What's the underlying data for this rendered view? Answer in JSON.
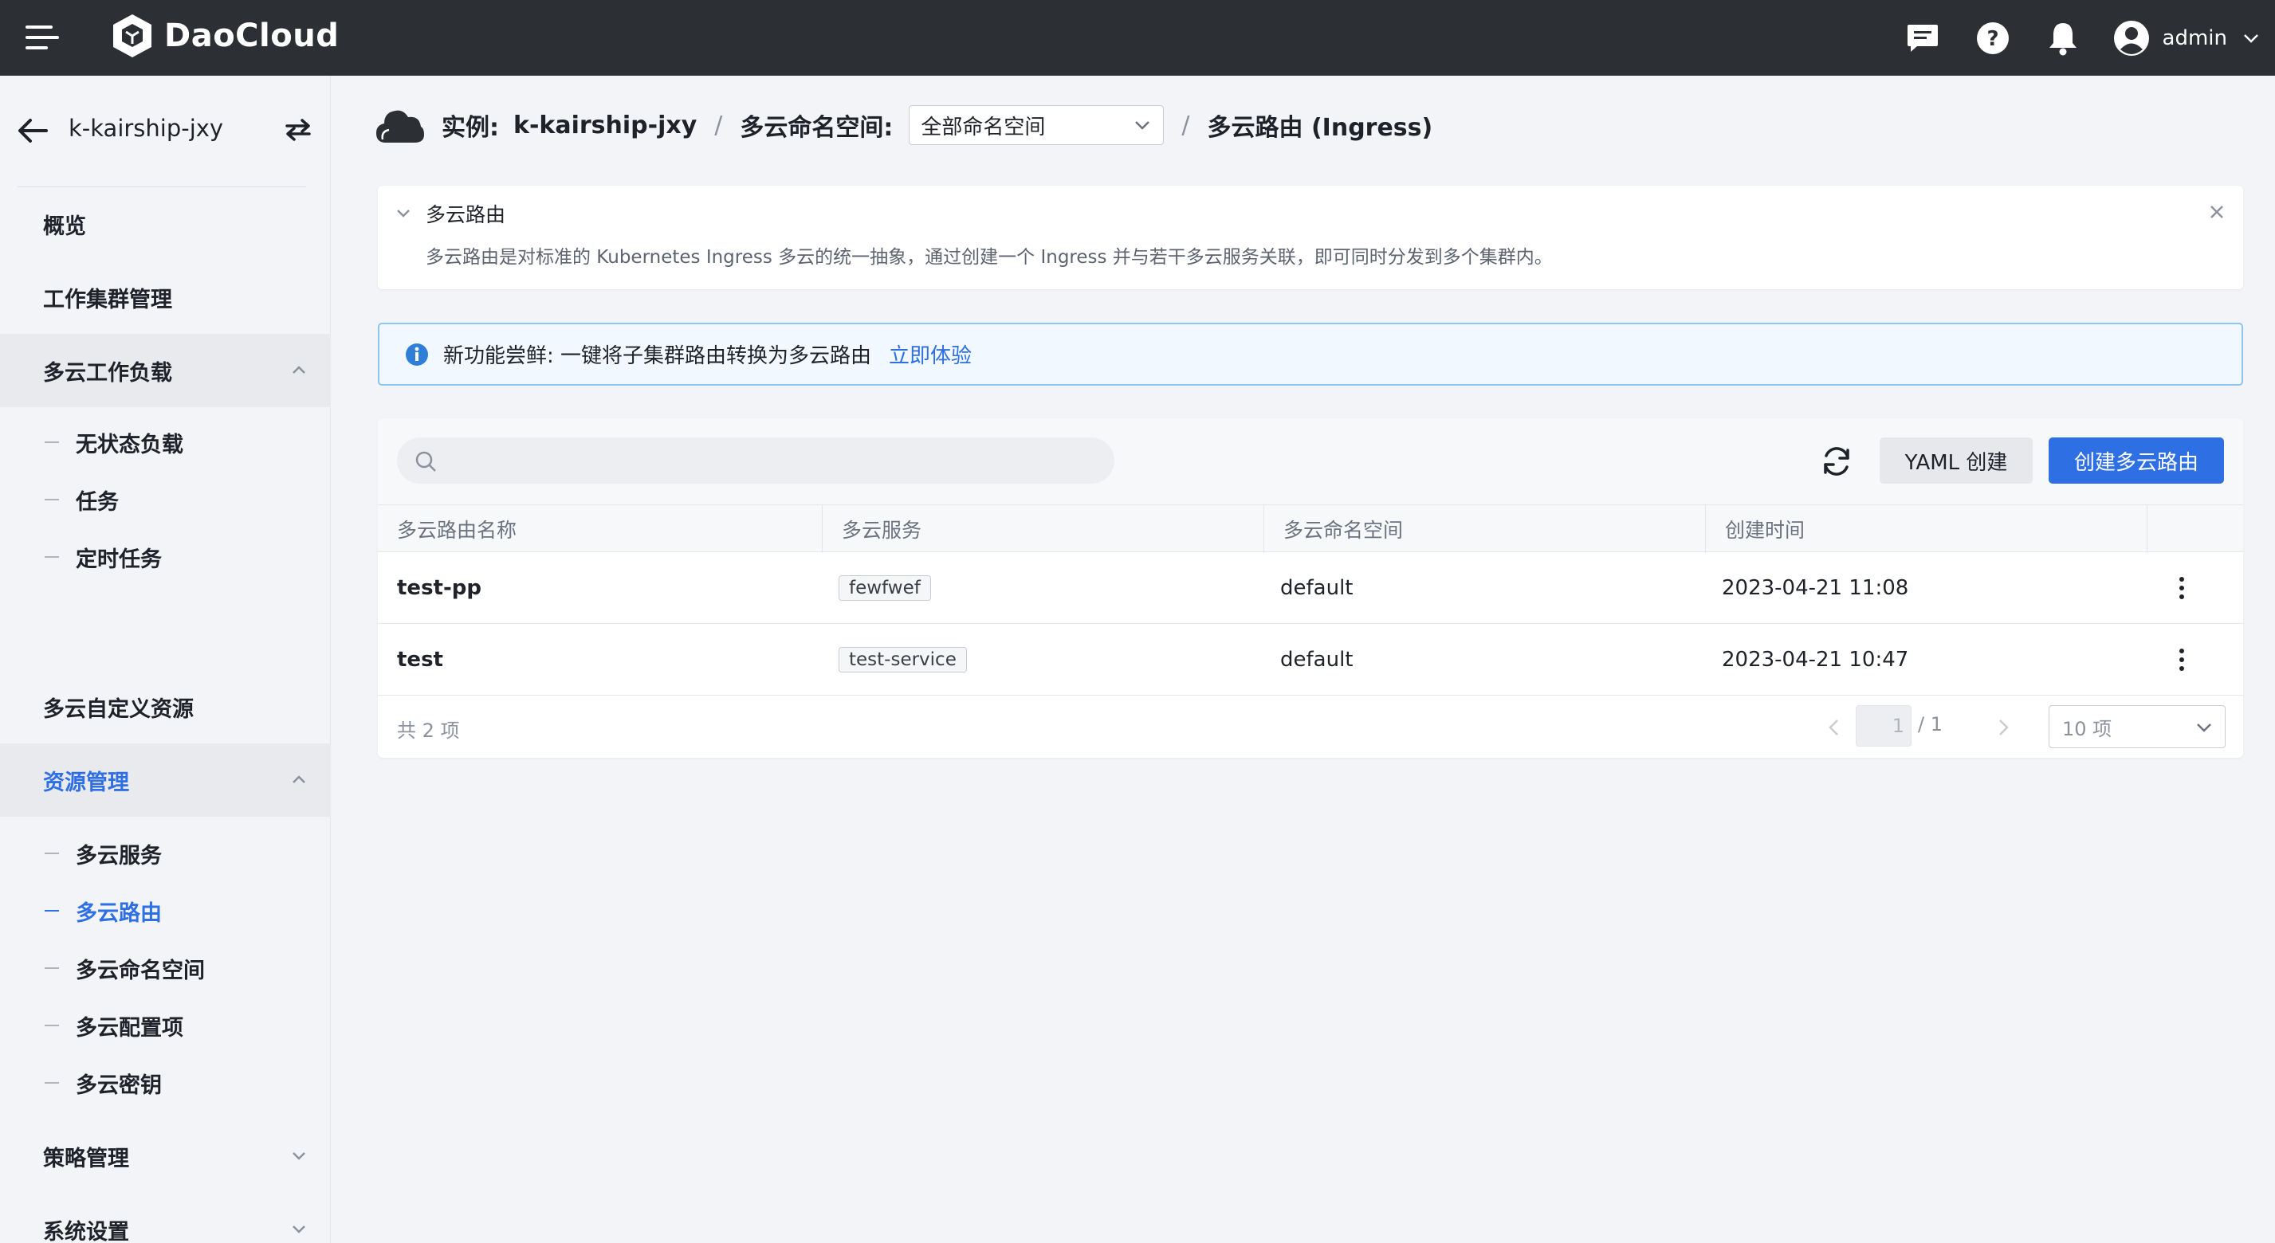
{
  "app": {
    "brand": "DaoCloud"
  },
  "topbar": {
    "user_name": "admin"
  },
  "sidebar": {
    "instance_name": "k-kairship-jxy",
    "items": [
      {
        "label": "概览"
      },
      {
        "label": "工作集群管理"
      },
      {
        "label": "多云工作负载",
        "children": [
          "无状态负载",
          "任务",
          "定时任务"
        ]
      },
      {
        "label": "多云自定义资源"
      },
      {
        "label": "资源管理",
        "children": [
          "多云服务",
          "多云路由",
          "多云命名空间",
          "多云配置项",
          "多云密钥"
        ]
      },
      {
        "label": "策略管理"
      },
      {
        "label": "系统设置"
      }
    ]
  },
  "breadcrumb": {
    "instance_label": "实例:",
    "instance_value": "k-kairship-jxy",
    "sep": "/",
    "ns_label": "多云命名空间:",
    "ns_selected": "全部命名空间",
    "current": "多云路由 (Ingress)"
  },
  "info": {
    "title": "多云路由",
    "description": "多云路由是对标准的 Kubernetes Ingress 多云的统一抽象，通过创建一个 Ingress 并与若干多云服务关联，即可同时分发到多个集群内。"
  },
  "alert": {
    "text": "新功能尝鲜: 一键将子集群路由转换为多云路由",
    "link": "立即体验"
  },
  "toolbar": {
    "search_placeholder": "",
    "yaml_label": "YAML 创建",
    "create_label": "创建多云路由"
  },
  "table": {
    "columns": [
      "多云路由名称",
      "多云服务",
      "多云命名空间",
      "创建时间"
    ],
    "rows": [
      {
        "name": "test-pp",
        "service": "fewfwef",
        "namespace": "default",
        "created": "2023-04-21 11:08"
      },
      {
        "name": "test",
        "service": "test-service",
        "namespace": "default",
        "created": "2023-04-21 10:47"
      }
    ]
  },
  "pagination": {
    "total": "共 2 项",
    "current_page": "1",
    "of_pages": "/ 1",
    "page_size": "10 项"
  },
  "colors": {
    "topbar": "#2c2f33",
    "accent": "#2f6fe4",
    "alert_border": "#8ec4ef"
  }
}
